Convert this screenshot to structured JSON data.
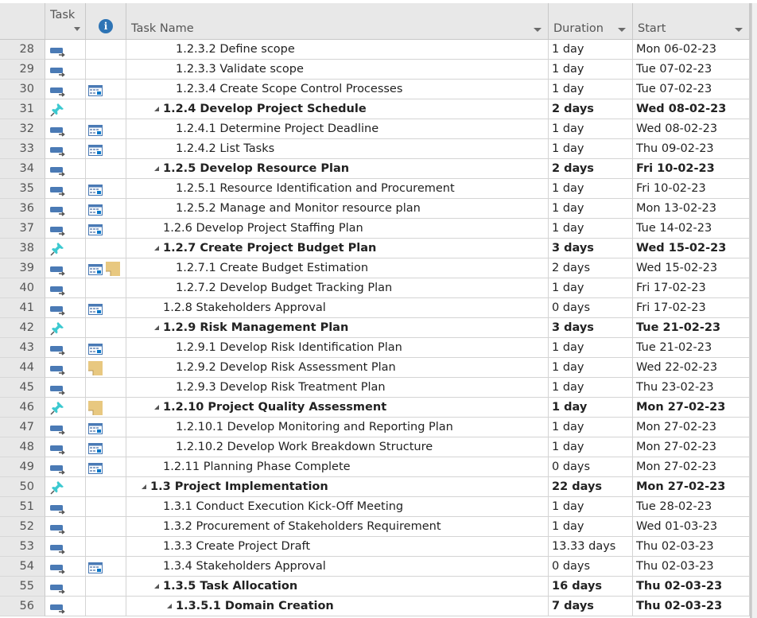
{
  "header": {
    "task_mode": "Task Mode",
    "info": "i",
    "task_name": "Task Name",
    "duration": "Duration",
    "start": "Start"
  },
  "colors": {
    "auto_task_icon": "#4a7ab5",
    "pin_icon": "#3cc9d0",
    "calendar_icon": "#4a7ab5",
    "note_icon": "#e8c880",
    "info_icon": "#2e74b5",
    "header_bg": "#e8e8e8"
  },
  "rows": [
    {
      "id": "28",
      "mode": "auto",
      "cal": false,
      "note": false,
      "level": 4,
      "summary": false,
      "name": "1.2.3.2 Define scope",
      "duration": "1 day",
      "start": "Mon 06-02-23"
    },
    {
      "id": "29",
      "mode": "auto",
      "cal": false,
      "note": false,
      "level": 4,
      "summary": false,
      "name": "1.2.3.3 Validate scope",
      "duration": "1 day",
      "start": "Tue 07-02-23"
    },
    {
      "id": "30",
      "mode": "auto",
      "cal": true,
      "note": false,
      "level": 4,
      "summary": false,
      "name": "1.2.3.4 Create Scope Control Processes",
      "duration": "1 day",
      "start": "Tue 07-02-23"
    },
    {
      "id": "31",
      "mode": "manual",
      "cal": false,
      "note": false,
      "level": 3,
      "summary": true,
      "name": "1.2.4 Develop Project Schedule",
      "duration": "2 days",
      "start": "Wed 08-02-23"
    },
    {
      "id": "32",
      "mode": "auto",
      "cal": true,
      "note": false,
      "level": 4,
      "summary": false,
      "name": "1.2.4.1 Determine Project Deadline",
      "duration": "1 day",
      "start": "Wed 08-02-23"
    },
    {
      "id": "33",
      "mode": "auto",
      "cal": true,
      "note": false,
      "level": 4,
      "summary": false,
      "name": "1.2.4.2 List Tasks",
      "duration": "1 day",
      "start": "Thu 09-02-23"
    },
    {
      "id": "34",
      "mode": "auto",
      "cal": false,
      "note": false,
      "level": 3,
      "summary": true,
      "name": "1.2.5 Develop Resource Plan",
      "duration": "2 days",
      "start": "Fri 10-02-23"
    },
    {
      "id": "35",
      "mode": "auto",
      "cal": true,
      "note": false,
      "level": 4,
      "summary": false,
      "name": "1.2.5.1 Resource Identification and Procurement",
      "duration": "1 day",
      "start": "Fri 10-02-23"
    },
    {
      "id": "36",
      "mode": "auto",
      "cal": true,
      "note": false,
      "level": 4,
      "summary": false,
      "name": "1.2.5.2 Manage and Monitor resource plan",
      "duration": "1 day",
      "start": "Mon 13-02-23"
    },
    {
      "id": "37",
      "mode": "auto",
      "cal": true,
      "note": false,
      "level": 3,
      "summary": false,
      "name": "1.2.6 Develop Project Staffing Plan",
      "duration": "1 day",
      "start": "Tue 14-02-23"
    },
    {
      "id": "38",
      "mode": "manual",
      "cal": false,
      "note": false,
      "level": 3,
      "summary": true,
      "name": "1.2.7 Create Project Budget Plan",
      "duration": "3 days",
      "start": "Wed 15-02-23"
    },
    {
      "id": "39",
      "mode": "auto",
      "cal": true,
      "note": true,
      "level": 4,
      "summary": false,
      "name": "1.2.7.1 Create Budget Estimation",
      "duration": "2 days",
      "start": "Wed 15-02-23"
    },
    {
      "id": "40",
      "mode": "auto",
      "cal": false,
      "note": false,
      "level": 4,
      "summary": false,
      "name": "1.2.7.2 Develop Budget Tracking Plan",
      "duration": "1 day",
      "start": "Fri 17-02-23"
    },
    {
      "id": "41",
      "mode": "auto",
      "cal": true,
      "note": false,
      "level": 3,
      "summary": false,
      "name": "1.2.8 Stakeholders Approval",
      "duration": "0 days",
      "start": "Fri 17-02-23"
    },
    {
      "id": "42",
      "mode": "manual",
      "cal": false,
      "note": false,
      "level": 3,
      "summary": true,
      "name": "1.2.9 Risk Management Plan",
      "duration": "3 days",
      "start": "Tue 21-02-23"
    },
    {
      "id": "43",
      "mode": "auto",
      "cal": true,
      "note": false,
      "level": 4,
      "summary": false,
      "name": "1.2.9.1 Develop Risk Identification Plan",
      "duration": "1 day",
      "start": "Tue 21-02-23"
    },
    {
      "id": "44",
      "mode": "auto",
      "cal": false,
      "note": true,
      "level": 4,
      "summary": false,
      "name": "1.2.9.2 Develop Risk Assessment Plan",
      "duration": "1 day",
      "start": "Wed 22-02-23"
    },
    {
      "id": "45",
      "mode": "auto",
      "cal": false,
      "note": false,
      "level": 4,
      "summary": false,
      "name": "1.2.9.3 Develop Risk Treatment Plan",
      "duration": "1 day",
      "start": "Thu 23-02-23"
    },
    {
      "id": "46",
      "mode": "manual",
      "cal": false,
      "note": true,
      "level": 3,
      "summary": true,
      "name": "1.2.10 Project Quality Assessment",
      "duration": "1 day",
      "start": "Mon 27-02-23"
    },
    {
      "id": "47",
      "mode": "auto",
      "cal": true,
      "note": false,
      "level": 4,
      "summary": false,
      "name": "1.2.10.1 Develop Monitoring and Reporting Plan",
      "duration": "1 day",
      "start": "Mon 27-02-23"
    },
    {
      "id": "48",
      "mode": "auto",
      "cal": true,
      "note": false,
      "level": 4,
      "summary": false,
      "name": "1.2.10.2 Develop Work Breakdown Structure",
      "duration": "1 day",
      "start": "Mon 27-02-23"
    },
    {
      "id": "49",
      "mode": "auto",
      "cal": true,
      "note": false,
      "level": 3,
      "summary": false,
      "name": "1.2.11 Planning Phase Complete",
      "duration": "0 days",
      "start": "Mon 27-02-23"
    },
    {
      "id": "50",
      "mode": "manual",
      "cal": false,
      "note": false,
      "level": 2,
      "summary": true,
      "name": "1.3 Project Implementation",
      "duration": "22 days",
      "start": "Mon 27-02-23"
    },
    {
      "id": "51",
      "mode": "auto",
      "cal": false,
      "note": false,
      "level": 3,
      "summary": false,
      "name": "1.3.1 Conduct Execution Kick-Off Meeting",
      "duration": "1 day",
      "start": "Tue 28-02-23"
    },
    {
      "id": "52",
      "mode": "auto",
      "cal": false,
      "note": false,
      "level": 3,
      "summary": false,
      "name": "1.3.2 Procurement of Stakeholders Requirement",
      "duration": "1 day",
      "start": "Wed 01-03-23"
    },
    {
      "id": "53",
      "mode": "auto",
      "cal": false,
      "note": false,
      "level": 3,
      "summary": false,
      "name": "1.3.3 Create Project Draft",
      "duration": "13.33 days",
      "start": "Thu 02-03-23"
    },
    {
      "id": "54",
      "mode": "auto",
      "cal": true,
      "note": false,
      "level": 3,
      "summary": false,
      "name": "1.3.4 Stakeholders Approval",
      "duration": "0 days",
      "start": "Thu 02-03-23"
    },
    {
      "id": "55",
      "mode": "auto",
      "cal": false,
      "note": false,
      "level": 3,
      "summary": true,
      "name": "1.3.5 Task Allocation",
      "duration": "16 days",
      "start": "Thu 02-03-23"
    },
    {
      "id": "56",
      "mode": "auto",
      "cal": false,
      "note": false,
      "level": 4,
      "summary": true,
      "name": "1.3.5.1 Domain Creation",
      "duration": "7 days",
      "start": "Thu 02-03-23"
    }
  ]
}
